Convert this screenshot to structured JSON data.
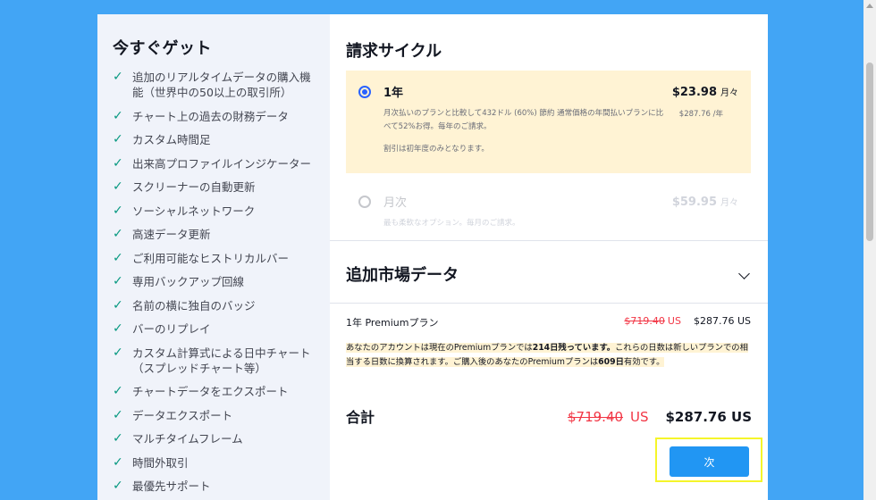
{
  "left": {
    "title": "今すぐゲット",
    "features": [
      "追加のリアルタイムデータの購入機能（世界中の50以上の取引所）",
      "チャート上の過去の財務データ",
      "カスタム時間足",
      "出来高プロファイルインジケーター",
      "スクリーナーの自動更新",
      "ソーシャルネットワーク",
      "高速データ更新",
      "ご利用可能なヒストリカルバー",
      "専用バックアップ回線",
      "名前の横に独自のバッジ",
      "バーのリプレイ",
      "カスタム計算式による日中チャート（スプレッドチャート等）",
      "チャートデータをエクスポート",
      "データエクスポート",
      "マルチタイムフレーム",
      "時間外取引",
      "最優先サポート"
    ]
  },
  "billing": {
    "title": "請求サイクル",
    "plans": [
      {
        "name": "1年",
        "price": "$23.98",
        "unit": "月々",
        "yearly": "$287.76 /年",
        "desc": "月次払いのプランと比較して432ドル (60%) 節約 通常価格の年間払いプランに比べて52%お得。毎年のご請求。",
        "note": "割引は初年度のみとなります。"
      },
      {
        "name": "月次",
        "price": "$59.95",
        "unit": "月々",
        "desc": "最も柔軟なオプション。毎月のご請求。"
      }
    ]
  },
  "market": {
    "title": "追加市場データ"
  },
  "summary": {
    "label": "1年 Premiumプラン",
    "old_price": "$719.40",
    "old_unit": "US",
    "new_price": "$287.76 US"
  },
  "notice": {
    "p1": "あなたのアカウントは現在のPremiumプランでは",
    "days_left": "214日残っています。",
    "p2": "これらの日数は新しいプランでの相当する日数に換算されます。ご購入後のあなたのPremiumプランは",
    "valid_days": "609日",
    "p3": "有効です。"
  },
  "total": {
    "label": "合計",
    "old_price": "$719.40",
    "old_unit": "US",
    "new_price": "$287.76 US"
  },
  "next_label": "次",
  "colors": {
    "accent": "#2196f3",
    "background": "#42a5f5",
    "highlight": "#fff3d4",
    "strike": "#f23645"
  }
}
